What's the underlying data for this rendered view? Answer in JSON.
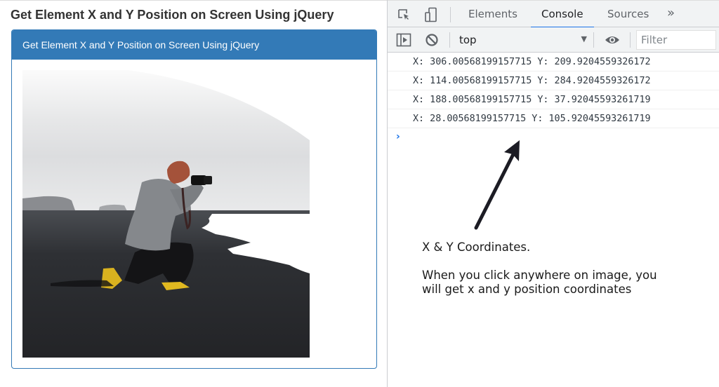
{
  "page": {
    "title": "Get Element X and Y Position on Screen Using jQuery",
    "panel_heading": "Get Element X and Y Position on Screen Using jQuery",
    "image_alt": "Photographer kneeling on a black sand beach taking a picture",
    "colors": {
      "panel_primary": "#337ab7"
    }
  },
  "devtools": {
    "toolbar_icons": [
      "inspect-element-icon",
      "device-toolbar-icon"
    ],
    "tabs": [
      {
        "label": "Elements",
        "active": false
      },
      {
        "label": "Console",
        "active": true
      },
      {
        "label": "Sources",
        "active": false
      }
    ],
    "more_tabs_label": "»",
    "console_toolbar": {
      "context": "top",
      "filter_placeholder": "Filter",
      "filter_value": ""
    },
    "logs": [
      "X: 306.00568199157715 Y: 209.9204559326172",
      "X: 114.00568199157715 Y: 284.9204559326172",
      "X: 188.00568199157715 Y: 37.92045593261719",
      "X: 28.00568199157715 Y: 105.92045593261719"
    ],
    "prompt_symbol": "›",
    "colors": {
      "active_tab_underline": "#1a73e8",
      "prompt": "#1a73e8"
    }
  },
  "annotation": {
    "title": "X & Y Coordinates.",
    "line1": "When you click anywhere on image, you",
    "line2": "will get x and y position coordinates"
  }
}
